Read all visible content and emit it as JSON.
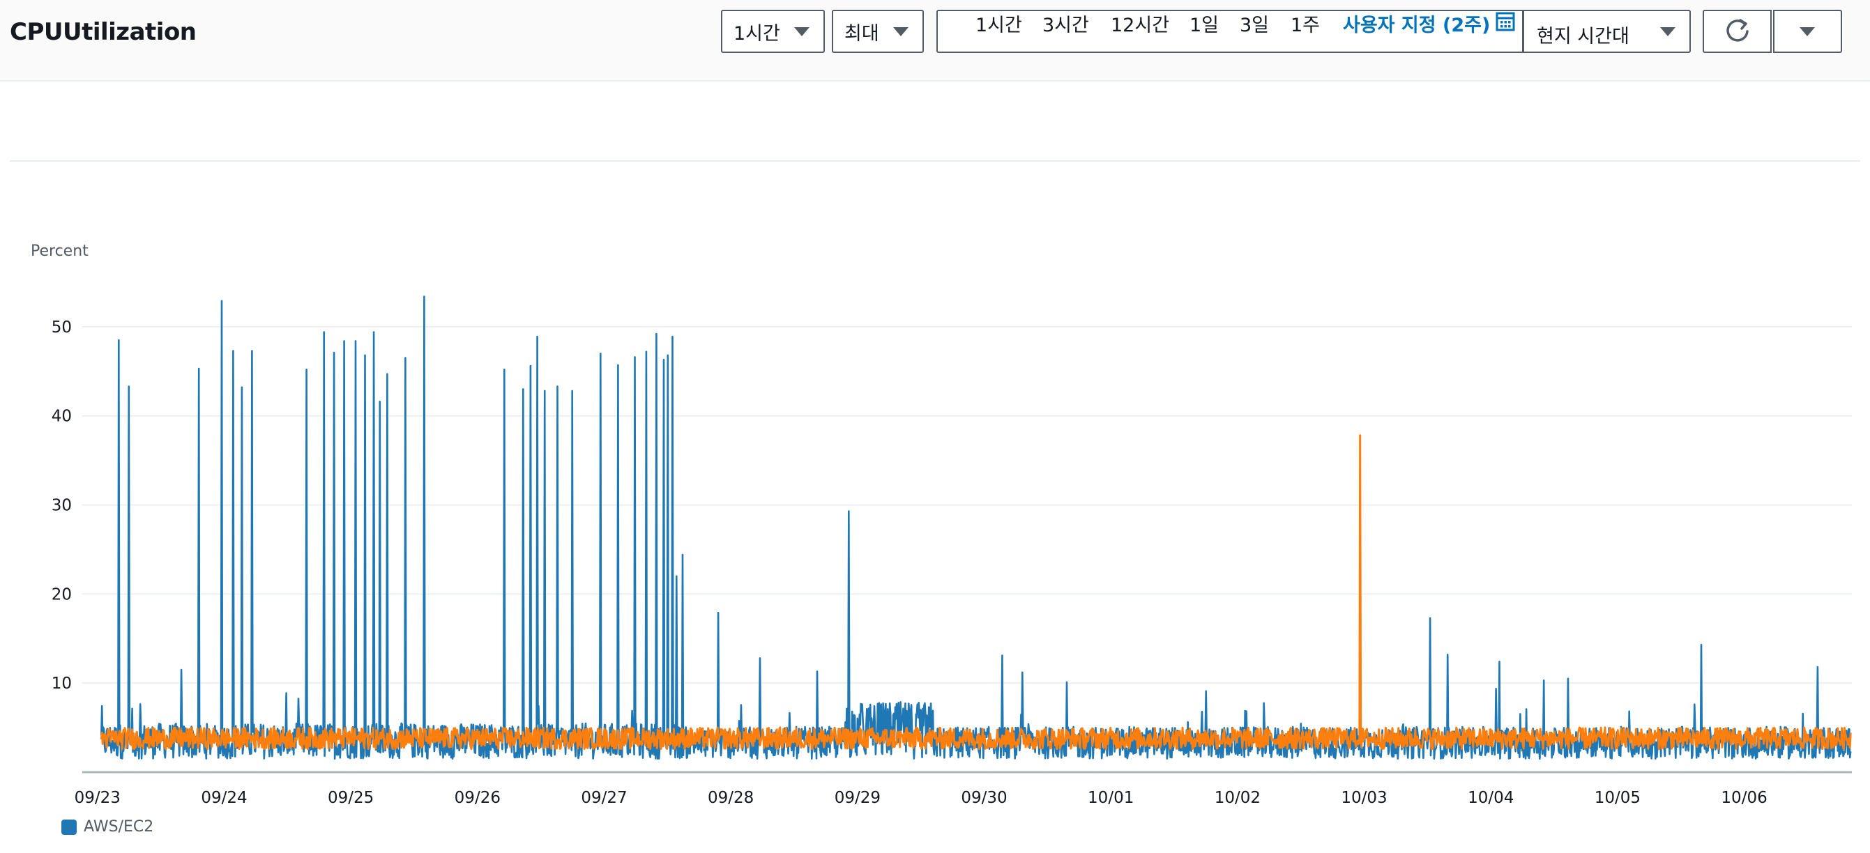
{
  "header": {
    "title": "CPUUtilization",
    "period_select": "1시간",
    "stat_select": "최대",
    "time_ranges": [
      "1시간",
      "3시간",
      "12시간",
      "1일",
      "3일",
      "1주"
    ],
    "custom_range": "사용자 지정 (2주)",
    "timezone_select": "현지 시간대"
  },
  "colors": {
    "accent": "#0073bb",
    "series_blue": "#1f77b4",
    "series_orange": "#ff7f0e",
    "grid": "#eaeded",
    "border": "#545b64"
  },
  "icons": {
    "calendar": "calendar-icon",
    "refresh": "refresh-icon",
    "dropdown": "caret-down-icon"
  },
  "chart_data": {
    "type": "line",
    "ylabel": "Percent",
    "ylim": [
      0,
      55
    ],
    "yticks": [
      10,
      20,
      30,
      40,
      50
    ],
    "x_ticks": [
      "09/23",
      "09/24",
      "09/25",
      "09/26",
      "09/27",
      "09/28",
      "09/29",
      "09/30",
      "10/01",
      "10/02",
      "10/03",
      "10/04",
      "10/05",
      "10/06"
    ],
    "x_range_days": [
      -0.12,
      13.85
    ],
    "grid": true,
    "legend_position": "bottom-left",
    "series": [
      {
        "name": "AWS/EC2",
        "color": "#1f77b4",
        "baseline": 1.5,
        "noise": 4.0,
        "peaks": [
          [
            0.17,
            48.5
          ],
          [
            0.25,
            43.3
          ],
          [
            0.66,
            11.5
          ],
          [
            0.8,
            45.3
          ],
          [
            0.98,
            52.9
          ],
          [
            1.07,
            47.3
          ],
          [
            1.14,
            43.2
          ],
          [
            1.22,
            47.3
          ],
          [
            1.65,
            45.2
          ],
          [
            1.79,
            49.4
          ],
          [
            1.87,
            47.1
          ],
          [
            1.95,
            48.4
          ],
          [
            2.04,
            48.4
          ],
          [
            2.11,
            46.8
          ],
          [
            2.18,
            49.4
          ],
          [
            2.23,
            41.6
          ],
          [
            2.29,
            44.7
          ],
          [
            2.43,
            46.5
          ],
          [
            2.58,
            53.4
          ],
          [
            3.21,
            45.2
          ],
          [
            3.36,
            43.0
          ],
          [
            3.42,
            45.6
          ],
          [
            3.47,
            48.9
          ],
          [
            3.53,
            42.8
          ],
          [
            3.63,
            43.3
          ],
          [
            3.75,
            42.8
          ],
          [
            3.97,
            47.0
          ],
          [
            4.11,
            45.7
          ],
          [
            4.24,
            46.6
          ],
          [
            4.33,
            47.2
          ],
          [
            4.41,
            49.2
          ],
          [
            4.47,
            46.3
          ],
          [
            4.5,
            46.8
          ],
          [
            4.54,
            48.9
          ],
          [
            4.57,
            22.0
          ],
          [
            4.62,
            24.4
          ],
          [
            4.9,
            17.9
          ],
          [
            5.23,
            12.8
          ],
          [
            5.68,
            11.3
          ],
          [
            5.93,
            29.3
          ],
          [
            7.14,
            13.1
          ],
          [
            7.3,
            11.2
          ],
          [
            7.65,
            10.1
          ],
          [
            8.75,
            9.1
          ],
          [
            9.97,
            10.7
          ],
          [
            10.52,
            17.3
          ],
          [
            10.66,
            13.2
          ],
          [
            11.07,
            12.4
          ],
          [
            11.42,
            10.3
          ],
          [
            11.61,
            10.5
          ],
          [
            12.66,
            14.3
          ],
          [
            13.58,
            11.8
          ]
        ]
      },
      {
        "name": "",
        "color": "#ff7f0e",
        "baseline": 2.6,
        "noise": 2.4,
        "peaks": [
          [
            9.97,
            37.8
          ]
        ]
      }
    ]
  },
  "legend": {
    "label": "AWS/EC2",
    "color": "#1f77b4"
  }
}
